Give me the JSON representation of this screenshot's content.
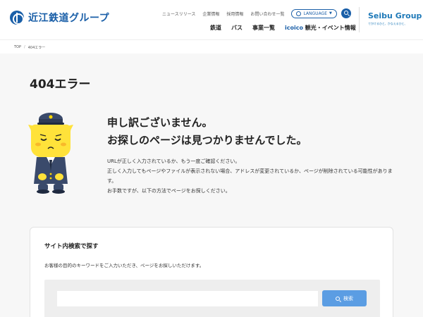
{
  "header": {
    "logo_text": "近江鉄道グループ",
    "top_links": [
      "ニュースリリース",
      "企業情報",
      "採用情報",
      "お問い合わせ一覧"
    ],
    "language_label": "LANGUAGE",
    "nav": [
      "鉄道",
      "バス",
      "事業一覧",
      "icoico",
      "観光・イベント情報"
    ],
    "seibu_title": "Seibu Group",
    "seibu_sub": "でかけるひと、かなえるひと、"
  },
  "breadcrumb": {
    "home": "TOP",
    "separator": "/",
    "current": "404エラー"
  },
  "page_title": "404エラー",
  "message": {
    "title_line1": "申し訳ございません。",
    "title_line2": "お探しのページは見つかりませんでした。",
    "body_line1": "URLが正しく入力されているか、もう一度ご確認ください。",
    "body_line2": "正しく入力してもページやファイルが表示されない場合、アドレスが変更されているか、ページが削除されている可能性があります。",
    "body_line3": "お手数ですが、以下の方法でページをお探しください。"
  },
  "search_card": {
    "title": "サイト内検索で探す",
    "description": "お客様の目的のキーワードをご入力いただき、ページをお探しいただけます。",
    "input_value": "",
    "input_placeholder": "",
    "button_label": "検索"
  },
  "colors": {
    "brand": "#1a5fa8",
    "seibu": "#1e79b8",
    "search_button": "#5b9de3",
    "mascot_yellow": "#ffe23a",
    "mascot_uniform": "#3a4a6b"
  },
  "icons": [
    "logo-icon",
    "globe-icon",
    "chevron-down-icon",
    "search-icon",
    "mascot-illustration"
  ]
}
